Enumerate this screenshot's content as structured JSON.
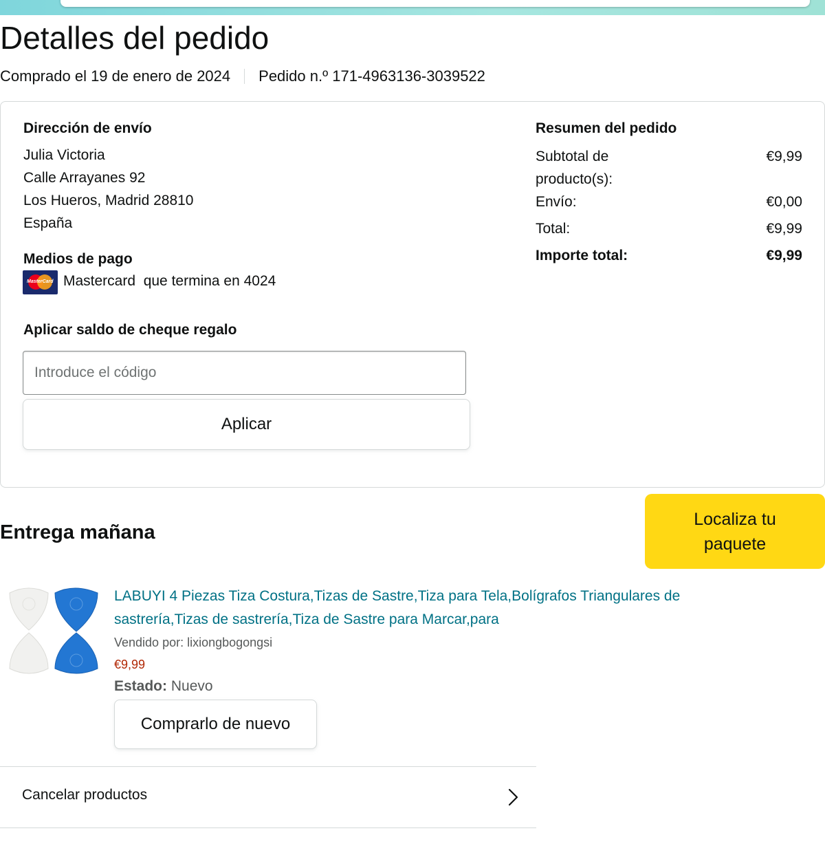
{
  "page": {
    "title": "Detalles del pedido",
    "purchased": "Comprado el 19 de enero de 2024",
    "order_number": "Pedido n.º 171-4963136-3039522"
  },
  "shipping": {
    "heading": "Dirección de envío",
    "lines": [
      "Julia Victoria",
      "Calle Arrayanes 92",
      "Los Hueros, Madrid 28810",
      "España"
    ]
  },
  "payment": {
    "heading": "Medios de pago",
    "card_text": "Mastercard  que termina en 4024",
    "card_icon": "mastercard-icon",
    "card_logo_text": "MasterCard"
  },
  "gift": {
    "heading": "Aplicar saldo de cheque regalo",
    "placeholder": "Introduce el código",
    "value": "",
    "button": "Aplicar"
  },
  "summary": {
    "heading": "Resumen del pedido",
    "subtotal_label_1": "Subtotal de",
    "subtotal_label_2": "producto(s):",
    "subtotal_value": "€9,99",
    "shipping_label": "Envío:",
    "shipping_value": "€0,00",
    "total_label": "Total:",
    "total_value": "€9,99",
    "grand_label": "Importe total:",
    "grand_value": "€9,99"
  },
  "delivery": {
    "title": "Entrega mañana",
    "track_button": "Localiza tu paquete"
  },
  "product": {
    "title": "LABUYI 4 Piezas Tiza Costura,Tizas de Sastre,Tiza para Tela,Bolígrafos Triangulares de sastrería,Tizas de sastrería,Tiza de Sastre para Marcar,para",
    "sold_by": "Vendido por: lixiongbogongsi",
    "price": "€9,99",
    "condition_label": "Estado:",
    "condition_value": " Nuevo",
    "buy_again": "Comprarlo de nuevo"
  },
  "actions": {
    "cancel": "Cancelar productos"
  },
  "colors": {
    "link": "#007185",
    "price": "#b12704",
    "track_button": "#ffd814",
    "border": "#d5d9d9"
  }
}
